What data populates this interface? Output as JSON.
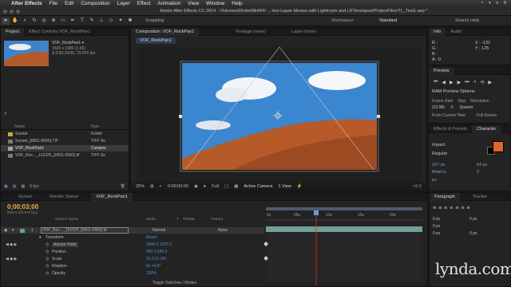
{
  "menubar": {
    "app": "After Effects",
    "items": [
      "File",
      "Edit",
      "Composition",
      "Layer",
      "Effect",
      "Animation",
      "View",
      "Window",
      "Help"
    ]
  },
  "titlebar": {
    "title": "Adobe After Effects CC 2014 - /Volumes/DroboMiniR4/ ... imo-Lapse Movies with Lightroom and LRTimelapse/ProjectFiles/TL_Test1.aep *"
  },
  "toolbar": {
    "snapping": "Snapping",
    "workspace_label": "Workspace:",
    "workspace_value": "Standard",
    "search_help": "Search Help"
  },
  "project": {
    "tabs": [
      "Project",
      "Effect Controls VOF_RockPan1"
    ],
    "selected_name": "VOF_RockPan1 ▾",
    "selected_info": [
      "1920 x 1080 (1.00)",
      "Δ 0;00;24;06, 23.976 fps"
    ],
    "columns": [
      "Name",
      "Type"
    ],
    "items": [
      {
        "name": "Sunset",
        "type": "Folder",
        "selected": false
      },
      {
        "name": "Sunset_[0001-0650].TIF",
        "type": "TIFF Se",
        "selected": false
      },
      {
        "name": "VOF_RockPan1",
        "type": "Compos",
        "selected": true
      },
      {
        "name": "VOF_Roc..._131025_[0001-0582].tif",
        "type": "TIFF Se",
        "selected": false
      }
    ],
    "bpc": "8 bpc"
  },
  "composition": {
    "tabs": [
      "Composition: VOF_RockPan1",
      "Footage (none)",
      "Layer (none)"
    ],
    "subtab": "VOF_RockPan1",
    "zoom": "25%",
    "timecode": "0:00:03:00",
    "resolution": "Full",
    "camera": "Active Camera",
    "views": "1 View",
    "exposure": "+0.0"
  },
  "info": {
    "tabs": [
      "Info",
      "Audio"
    ],
    "rgb": [
      "R :",
      "G :",
      "B :",
      "A : 0"
    ],
    "xy": [
      "X : -131",
      "Y : 125"
    ]
  },
  "preview": {
    "tab": "Preview",
    "ram_options": "RAM Preview Options",
    "labels": [
      "Frame Rate",
      "Skip",
      "Resolution"
    ],
    "values": [
      "(23.98)",
      "0",
      "Quarter"
    ],
    "from": "From Current Time",
    "full": "Full Screen"
  },
  "character": {
    "tabs": [
      "Effects & Presets",
      "Character"
    ],
    "font": "Impact",
    "style": "Regular",
    "size": "167 px",
    "leading": "64 px",
    "tracking": "Metrics",
    "tracking_val": "0",
    "unit": "px"
  },
  "timeline": {
    "tabs": [
      "Sunset",
      "Render Queue",
      "VOF_RockPan1"
    ],
    "timecode": "0;00;03;00",
    "timecode_sub": "00072 (23.976 fps)",
    "columns": [
      "Source Name",
      "Mode",
      "T",
      "TrkMat",
      "Parent"
    ],
    "layer": {
      "index": "1",
      "name": "VOF_Roc..._131025_[0001-0582].tif",
      "mode": "Normal",
      "parent": "None"
    },
    "transform": "Transform",
    "reset": "Reset",
    "properties": [
      {
        "name": "Anchor Point",
        "value": "1946.5,1375.0"
      },
      {
        "name": "Position",
        "value": "960.0,540.0"
      },
      {
        "name": "Scale",
        "value": "51.0,51.0%"
      },
      {
        "name": "Rotation",
        "value": "0x +0.0°"
      },
      {
        "name": "Opacity",
        "value": "100%"
      }
    ],
    "ruler": [
      "0s",
      "05s",
      "10s",
      "15s",
      "20s"
    ],
    "toggles": "Toggle Switches / Modes"
  },
  "paragraph": {
    "tabs": [
      "Paragraph",
      "Tracker"
    ],
    "values": [
      "0 px",
      "0 px",
      "0 px",
      "0 px",
      "0 px"
    ]
  },
  "watermark": "lynda.com",
  "colors": {
    "accent_blue": "#4f93d6",
    "timecode_yellow": "#e8b246",
    "layer_teal": "#6fa09a",
    "swatch_orange": "#e0652a"
  }
}
